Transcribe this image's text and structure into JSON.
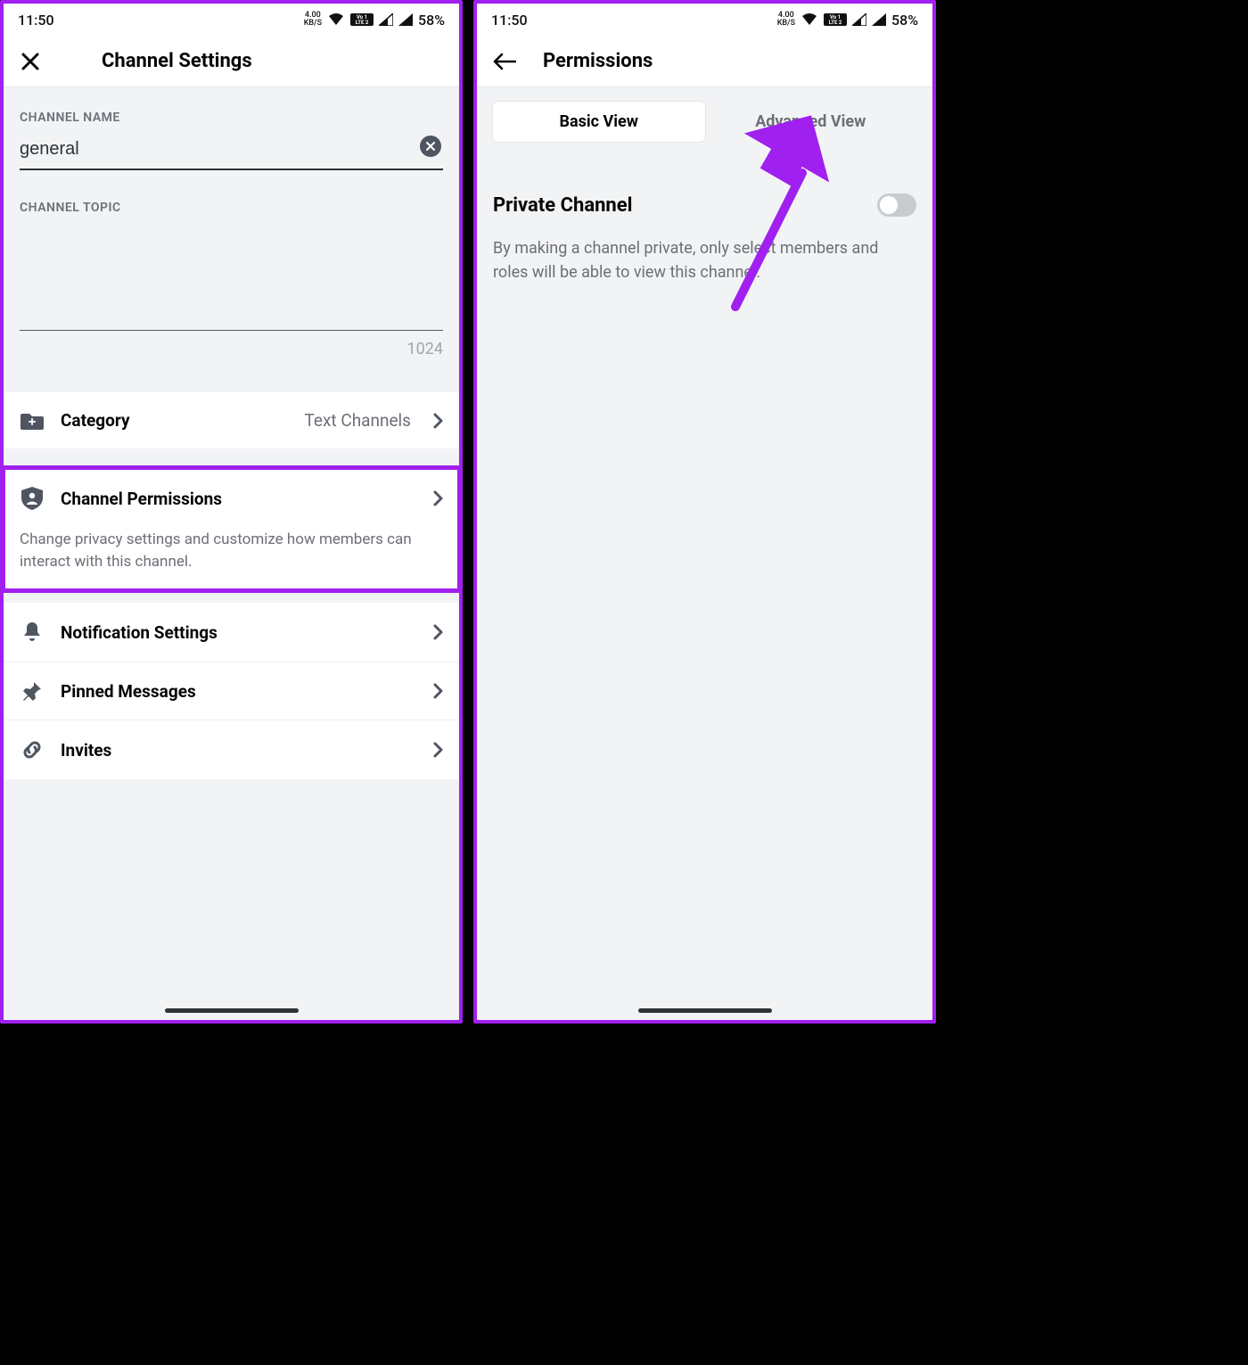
{
  "statusbar": {
    "time": "11:50",
    "speed_top": "4.00",
    "speed_bot": "KB/S",
    "battery": "58%"
  },
  "left": {
    "header_title": "Channel Settings",
    "channel_name_label": "CHANNEL NAME",
    "channel_name_value": "general",
    "channel_topic_label": "CHANNEL TOPIC",
    "topic_counter": "1024",
    "rows": {
      "category": {
        "label": "Category",
        "value": "Text Channels"
      },
      "permissions": {
        "label": "Channel Permissions",
        "desc": "Change privacy settings and customize how members can interact with this channel."
      },
      "notifications": {
        "label": "Notification Settings"
      },
      "pinned": {
        "label": "Pinned Messages"
      },
      "invites": {
        "label": "Invites"
      }
    }
  },
  "right": {
    "header_title": "Permissions",
    "tabs": {
      "basic": "Basic View",
      "advanced": "Advanced View"
    },
    "private_title": "Private Channel",
    "private_desc": "By making a channel private, only select members and roles will be able to view this channel."
  }
}
